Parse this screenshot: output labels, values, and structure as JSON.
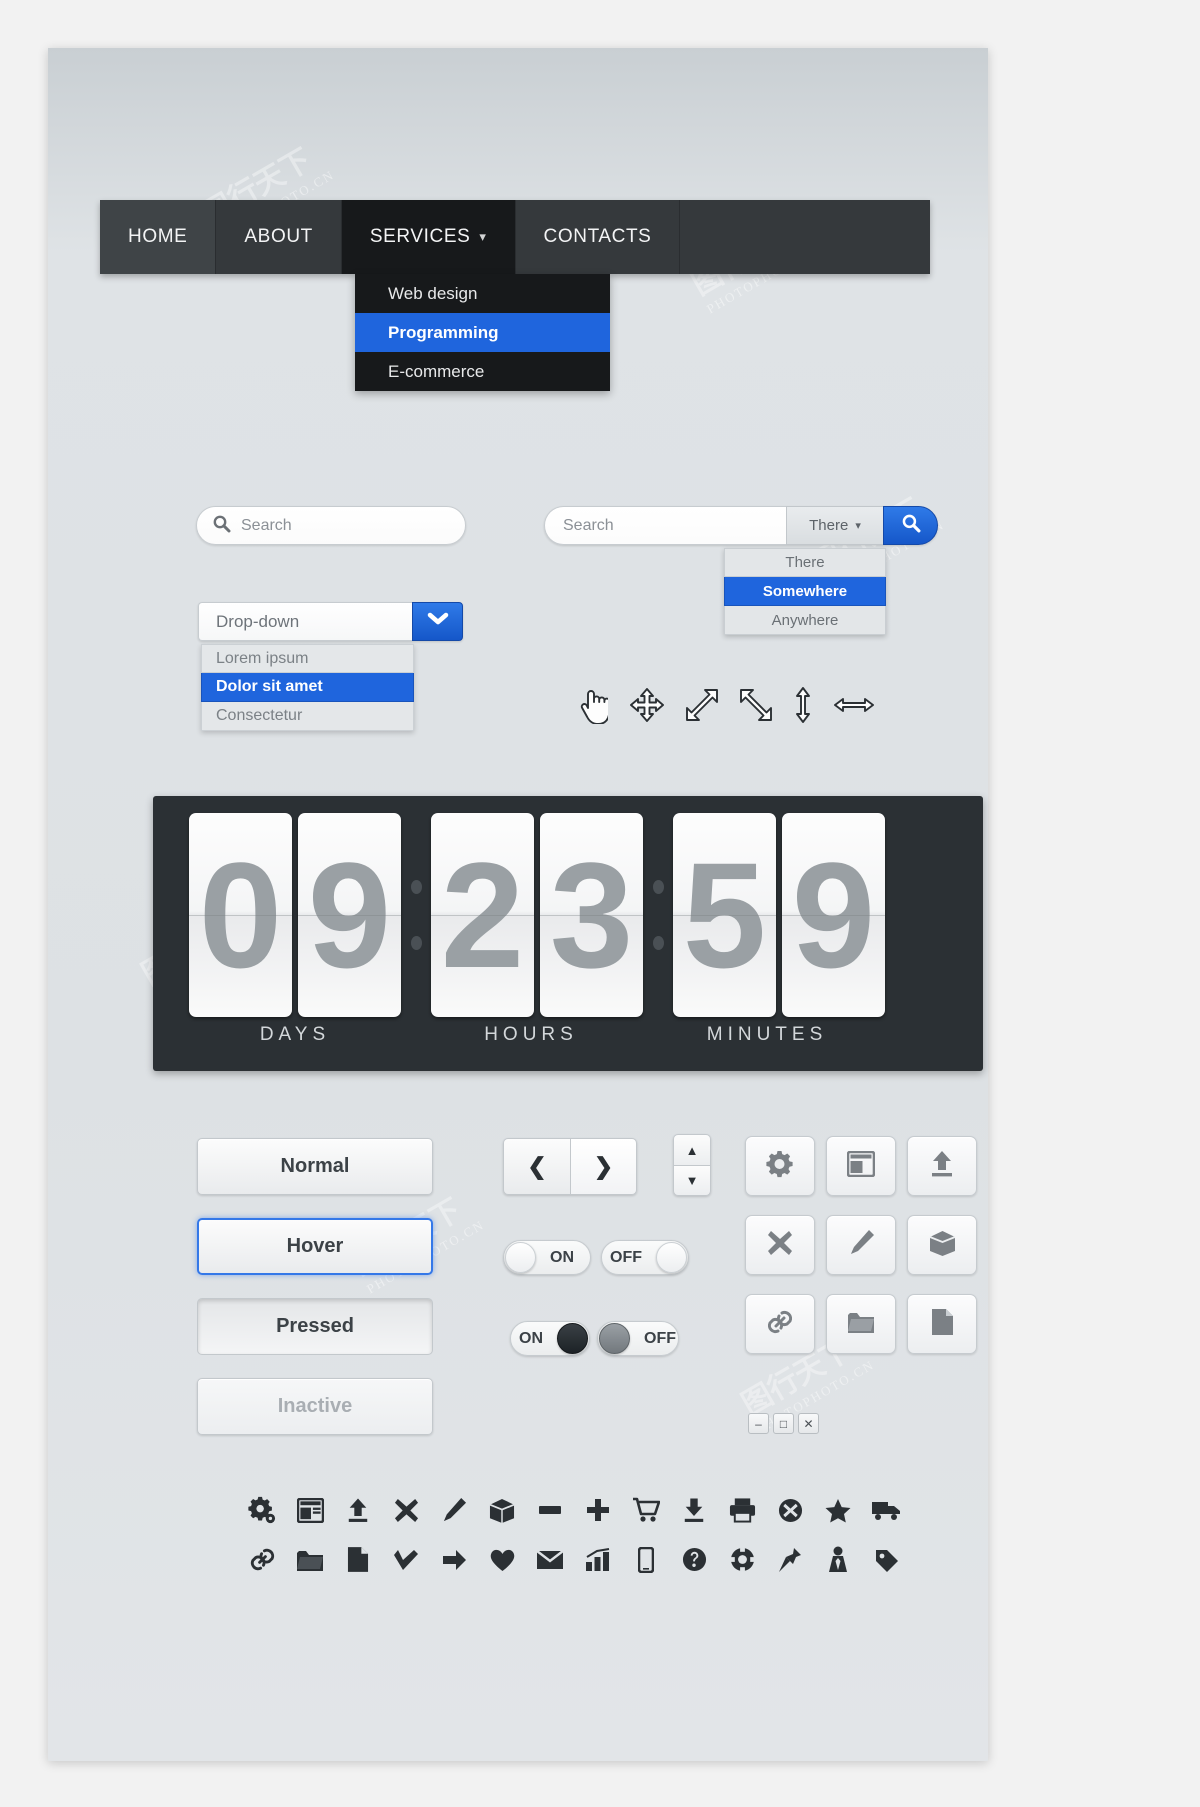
{
  "nav": {
    "items": [
      {
        "label": "HOME",
        "state": "active"
      },
      {
        "label": "ABOUT",
        "state": "normal"
      },
      {
        "label": "SERVICES",
        "state": "open",
        "caret": "chevron-down"
      },
      {
        "label": "CONTACTS",
        "state": "normal"
      }
    ],
    "submenu": [
      {
        "label": "Web design",
        "selected": false
      },
      {
        "label": "Programming",
        "selected": true
      },
      {
        "label": "E-commerce",
        "selected": false
      }
    ]
  },
  "search_simple": {
    "placeholder": "Search",
    "icon": "search-icon"
  },
  "search_combo": {
    "placeholder": "Search",
    "scope_value": "There",
    "button_icon": "search-icon",
    "options": [
      {
        "label": "There",
        "selected": false
      },
      {
        "label": "Somewhere",
        "selected": true
      },
      {
        "label": "Anywhere",
        "selected": false
      }
    ]
  },
  "dropdown": {
    "value": "Drop-down",
    "toggle_icon": "chevron-down-icon",
    "options": [
      {
        "label": "Lorem ipsum",
        "selected": false
      },
      {
        "label": "Dolor sit amet",
        "selected": true
      },
      {
        "label": "Consectetur",
        "selected": false
      }
    ]
  },
  "cursors": [
    {
      "name": "pointing-hand-cursor"
    },
    {
      "name": "move-cursor"
    },
    {
      "name": "resize-ne-sw-cursor"
    },
    {
      "name": "resize-nw-se-cursor"
    },
    {
      "name": "resize-vertical-cursor"
    },
    {
      "name": "resize-horizontal-cursor"
    }
  ],
  "countdown": {
    "groups": [
      {
        "label": "DAYS",
        "digits": [
          "0",
          "9"
        ]
      },
      {
        "label": "HOURS",
        "digits": [
          "2",
          "3"
        ]
      },
      {
        "label": "MINUTES",
        "digits": [
          "5",
          "9"
        ]
      }
    ],
    "separator": ":"
  },
  "buttons": [
    {
      "label": "Normal",
      "state": "normal"
    },
    {
      "label": "Hover",
      "state": "hover"
    },
    {
      "label": "Pressed",
      "state": "pressed"
    },
    {
      "label": "Inactive",
      "state": "inactive"
    }
  ],
  "steppers": {
    "prev_icon": "chevron-left-icon",
    "next_icon": "chevron-right-icon",
    "up_icon": "chevron-up-icon",
    "down_icon": "chevron-down-icon"
  },
  "toggles": [
    {
      "label": "ON",
      "style": "light-knob-left"
    },
    {
      "label": "OFF",
      "style": "light-knob-right"
    },
    {
      "label": "ON",
      "style": "dark-knob-right"
    },
    {
      "label": "OFF",
      "style": "gray-knob-left"
    }
  ],
  "icon_buttons": [
    {
      "name": "gears-icon"
    },
    {
      "name": "window-icon"
    },
    {
      "name": "upload-icon"
    },
    {
      "name": "close-x-icon"
    },
    {
      "name": "pencil-icon"
    },
    {
      "name": "box-icon"
    },
    {
      "name": "link-icon"
    },
    {
      "name": "folder-icon"
    },
    {
      "name": "file-icon"
    }
  ],
  "window_controls": [
    {
      "name": "minimize-icon",
      "glyph": "–"
    },
    {
      "name": "maximize-icon",
      "glyph": "□"
    },
    {
      "name": "close-icon",
      "glyph": "✕"
    }
  ],
  "icon_set": {
    "row1": [
      {
        "name": "gears-icon"
      },
      {
        "name": "window-icon"
      },
      {
        "name": "upload-icon"
      },
      {
        "name": "close-x-icon"
      },
      {
        "name": "pencil-icon"
      },
      {
        "name": "box-icon"
      },
      {
        "name": "minus-icon"
      },
      {
        "name": "plus-icon"
      },
      {
        "name": "cart-icon"
      },
      {
        "name": "download-icon"
      },
      {
        "name": "printer-icon"
      },
      {
        "name": "error-circle-icon"
      },
      {
        "name": "star-icon"
      },
      {
        "name": "truck-icon"
      }
    ],
    "row2": [
      {
        "name": "link-icon"
      },
      {
        "name": "folder-icon"
      },
      {
        "name": "file-icon"
      },
      {
        "name": "check-icon"
      },
      {
        "name": "arrow-right-icon"
      },
      {
        "name": "heart-icon"
      },
      {
        "name": "mail-icon"
      },
      {
        "name": "bar-chart-icon"
      },
      {
        "name": "phone-icon"
      },
      {
        "name": "question-icon"
      },
      {
        "name": "support-icon"
      },
      {
        "name": "pin-icon"
      },
      {
        "name": "tie-icon"
      },
      {
        "name": "tag-icon"
      }
    ]
  },
  "colors": {
    "accent": "#1f65dd",
    "nav_dark": "#35393c",
    "nav_open": "#17191b",
    "clock_bg": "#2b3034"
  },
  "watermark": {
    "line1": "图行天下",
    "line2": "PHOTOPHOTO.CN"
  }
}
